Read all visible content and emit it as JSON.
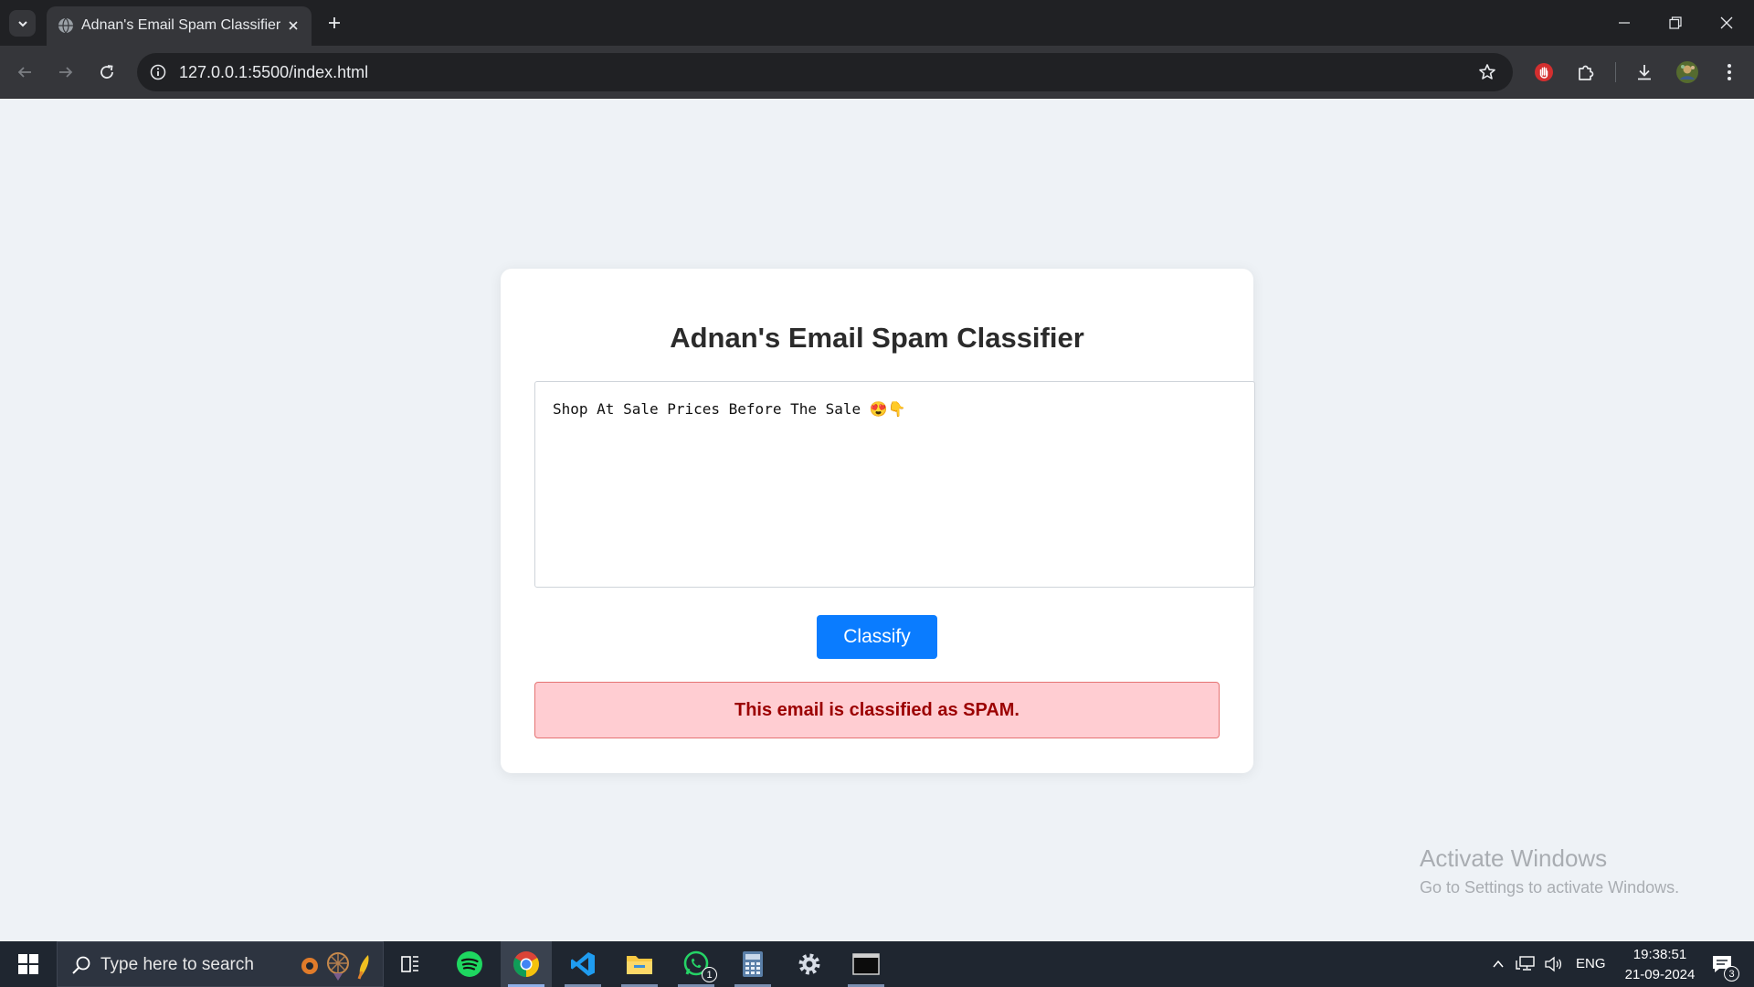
{
  "browser": {
    "tab_title": "Adnan's Email Spam Classifier",
    "url": "127.0.0.1:5500/index.html"
  },
  "page": {
    "title": "Adnan's Email Spam Classifier",
    "email_text": "Shop At Sale Prices Before The Sale 😍👇",
    "classify_label": "Classify",
    "result_text": "This email is classified as SPAM.",
    "result_status": "spam",
    "colors": {
      "button": "#0a7cff",
      "result_bg": "#ffcdd2",
      "result_text": "#9b0000"
    }
  },
  "watermark": {
    "title": "Activate Windows",
    "subtitle": "Go to Settings to activate Windows."
  },
  "taskbar": {
    "search_placeholder": "Type here to search",
    "apps": [
      "task-view",
      "spotify",
      "chrome",
      "vscode",
      "file-explorer",
      "whatsapp",
      "calculator",
      "settings",
      "terminal"
    ],
    "whatsapp_badge": "1",
    "language": "ENG",
    "time": "19:38:51",
    "date": "21-09-2024",
    "notification_count": "3"
  }
}
